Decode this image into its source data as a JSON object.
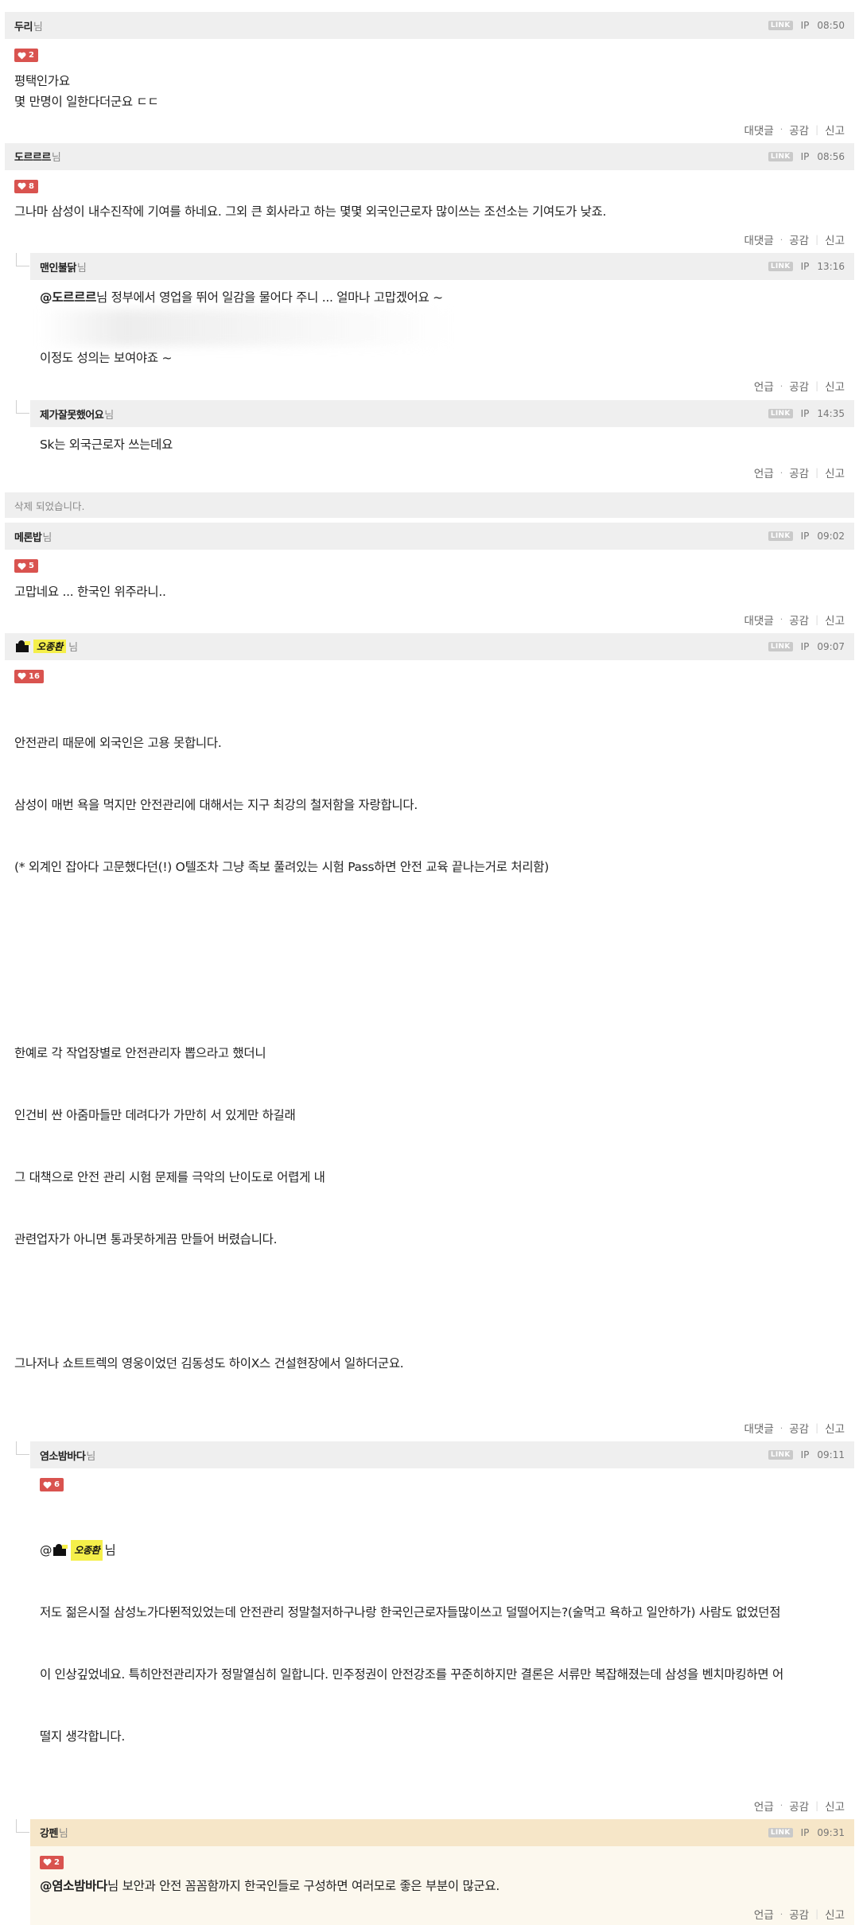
{
  "labels": {
    "nim": "님",
    "link": "LINK",
    "ip": "IP",
    "reply": "대댓글",
    "mention": "언급",
    "like": "공감",
    "report": "신고",
    "dot": "·",
    "sep": "|"
  },
  "comments": [
    {
      "nick": "두리",
      "time": "08:50",
      "likes": "2",
      "lines": [
        "평택인가요",
        "몇 만명이 일한다더군요 ㄷㄷ"
      ]
    },
    {
      "nick": "도르르르",
      "time": "08:56",
      "likes": "8",
      "lines": [
        "그나마 삼성이 내수진작에 기여를 하네요. 그외 큰 회사라고 하는 몇몇 외국인근로자 많이쓰는 조선소는 기여도가 낮죠."
      ]
    },
    {
      "nick": "맨인불닭",
      "time": "13:16",
      "mention": "@도르르르",
      "line1": "님 정부에서 영업을 뛰어 일감을 물어다 주니 ... 얼마나 고맙겠어요 ~",
      "line2": "이정도 성의는 보여야죠 ~"
    },
    {
      "nick": "제가잘못했어요",
      "time": "14:35",
      "lines": [
        "Sk는 외국근로자 쓰는데요"
      ]
    },
    {
      "deleted": "삭제 되었습니다."
    },
    {
      "nick": "메론밥",
      "time": "09:02",
      "likes": "5",
      "lines": [
        "고맙네요 ... 한국인 위주라니.."
      ]
    },
    {
      "nick": "오종환",
      "time": "09:07",
      "likes": "16",
      "lines": [
        "안전관리 때문에 외국인은 고용 못합니다.",
        "삼성이 매번 욕을 먹지만 안전관리에 대해서는 지구 최강의 철저함을 자랑합니다.",
        "(* 외계인 잡아다 고문했다던(!) O텔조차 그냥 족보 풀려있는 시험 Pass하면 안전 교육 끝나는거로 처리함)",
        "",
        "",
        "한예로 각 작업장별로 안전관리자 뽑으라고 했더니",
        "인건비 싼 아줌마들만 데려다가 가만히 서 있게만 하길래",
        "그 대책으로 안전 관리 시험 문제를 극악의 난이도로 어렵게 내",
        "관련업자가 아니면 통과못하게끔 만들어 버렸습니다.",
        "",
        "그나저나 쇼트트렉의 영웅이었던 김동성도 하이X스 건설현장에서 일하더군요."
      ]
    },
    {
      "nick": "염소밤바다",
      "time": "09:11",
      "likes": "6",
      "mention_at": "@",
      "mention_nick": "오종환",
      "lines": [
        "저도 젊은시절 삼성노가다뛴적있었는데 안전관리 정말철저하구나랑 한국인근로자들많이쓰고 덜떨어지는?(술먹고 욕하고 일안하가) 사람도 없었던점",
        "이 인상깊었네요. 특히안전관리자가 정말열심히 일합니다. 민주정권이 안전강조를 꾸준히하지만 결론은 서류만 복잡해졌는데 삼성을 벤치마킹하면 어",
        "떨지 생각합니다."
      ]
    },
    {
      "nick": "강펜",
      "time": "09:31",
      "likes": "2",
      "mention": "@염소밤바다",
      "line1": "님 보안과 안전 꼼꼼함까지 한국인들로 구성하면 여러모로 좋은 부분이 많군요."
    }
  ],
  "colors": {
    "like_badge": "#d9534f",
    "header_bg": "#efefef",
    "highlight_header": "#f6e6c8",
    "highlight_body": "#fcf8ee"
  }
}
